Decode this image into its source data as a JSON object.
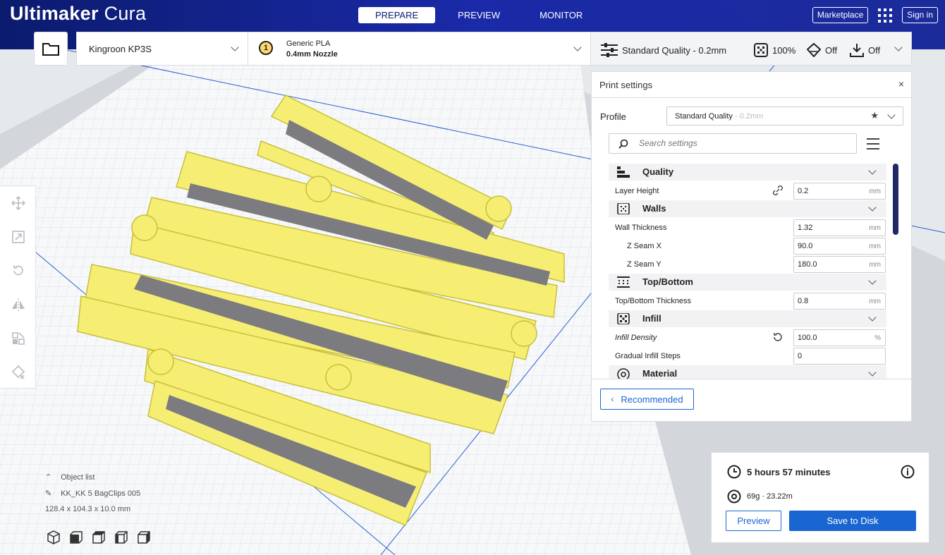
{
  "app": {
    "logo_bold": "Ultimaker",
    "logo_light": " Cura"
  },
  "stages": [
    {
      "label": "PREPARE",
      "active": true
    },
    {
      "label": "PREVIEW",
      "active": false
    },
    {
      "label": "MONITOR",
      "active": false
    }
  ],
  "header": {
    "marketplace_label": "Marketplace",
    "signin_label": "Sign in"
  },
  "machine": {
    "printer": "Kingroon KP3S",
    "extruder_number": "1",
    "material": "Generic PLA",
    "nozzle": "0.4mm Nozzle"
  },
  "quality_bar": {
    "profile": "Standard Quality - 0.2mm",
    "infill": "100%",
    "support": "Off",
    "adhesion": "Off"
  },
  "print_settings": {
    "title": "Print settings",
    "close_glyph": "×",
    "profile_label": "Profile",
    "profile_value": "Standard Quality",
    "profile_suffix": " - 0.2mm",
    "search_placeholder": "Search settings",
    "categories": {
      "quality": "Quality",
      "walls": "Walls",
      "topbottom": "Top/Bottom",
      "infill": "Infill",
      "material": "Material"
    },
    "rows": {
      "layer_height": {
        "label": "Layer Height",
        "value": "0.2",
        "unit": "mm"
      },
      "wall_thickness": {
        "label": "Wall Thickness",
        "value": "1.32",
        "unit": "mm"
      },
      "z_seam_x": {
        "label": "Z Seam X",
        "value": "90.0",
        "unit": "mm"
      },
      "z_seam_y": {
        "label": "Z Seam Y",
        "value": "180.0",
        "unit": "mm"
      },
      "topbottom_thickness": {
        "label": "Top/Bottom Thickness",
        "value": "0.8",
        "unit": "mm"
      },
      "infill_density": {
        "label": "Infill Density",
        "value": "100.0",
        "unit": "%"
      },
      "gradual_infill": {
        "label": "Gradual Infill Steps",
        "value": "0",
        "unit": ""
      }
    },
    "recommended_label": "Recommended"
  },
  "object_info": {
    "list_label": "Object list",
    "object_name": "KK_KK 5 BagClips 005",
    "dimensions": "128.4 x 104.3 x 10.0 mm"
  },
  "estimate": {
    "time": "5 hours 57 minutes",
    "material": "69g · 23.22m",
    "preview_label": "Preview",
    "save_label": "Save to Disk"
  },
  "colors": {
    "header_dark": "#0b1b6e",
    "accent": "#1966d2",
    "model": "#f6ee73"
  }
}
